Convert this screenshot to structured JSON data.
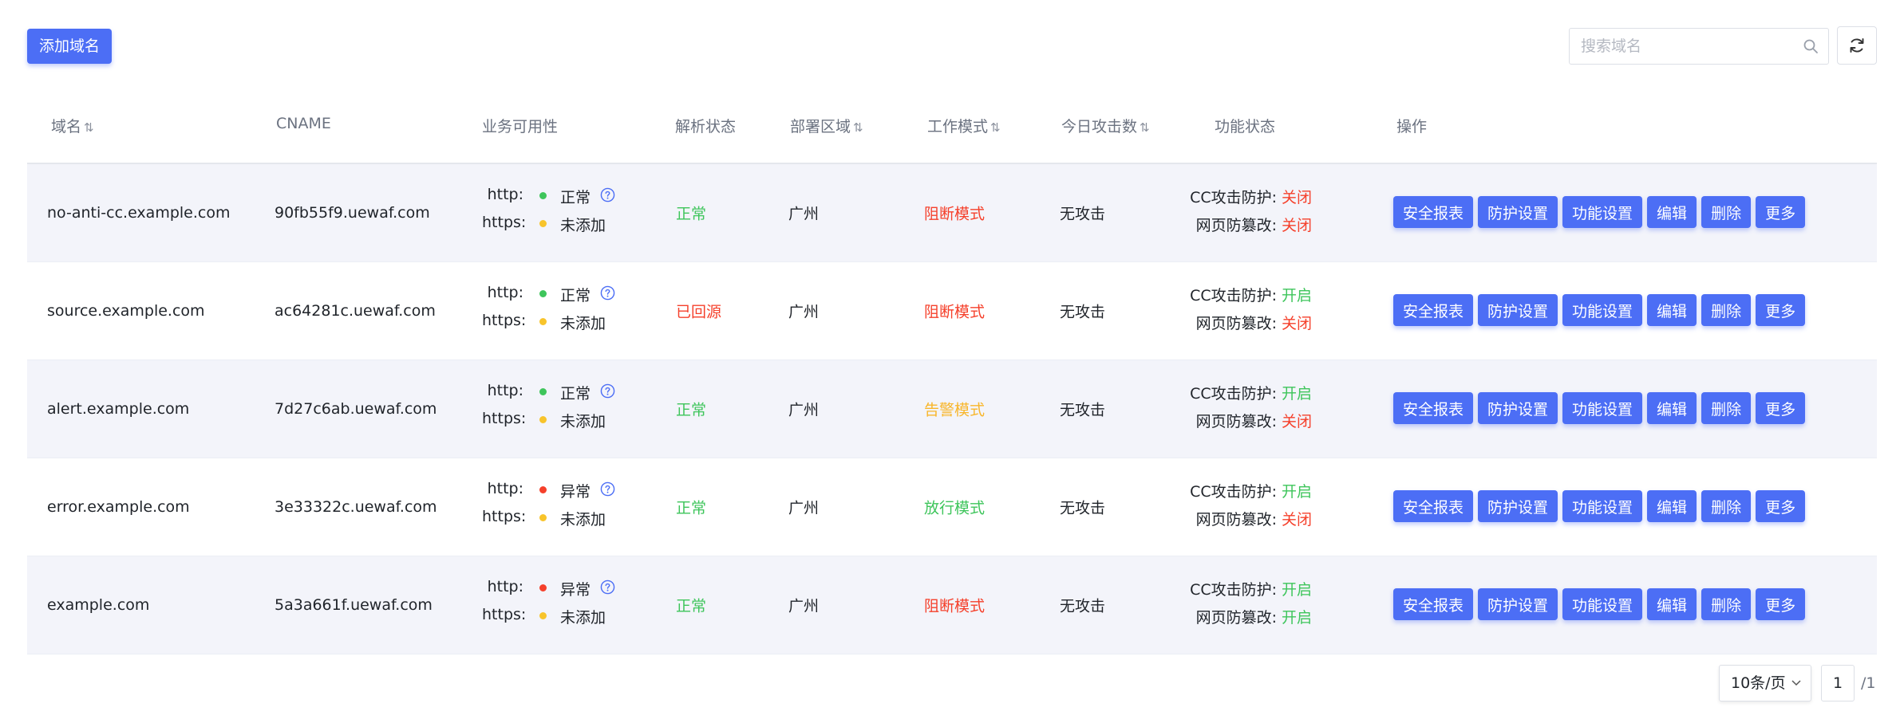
{
  "toolbar": {
    "add_label": "添加域名",
    "search_placeholder": "搜索域名"
  },
  "columns": {
    "domain": "域名",
    "cname": "CNAME",
    "availability": "业务可用性",
    "dns_status": "解析状态",
    "region": "部署区域",
    "mode": "工作模式",
    "attacks": "今日攻击数",
    "features": "功能状态",
    "actions": "操作"
  },
  "sort_glyph": "⇅",
  "labels": {
    "http": "http:",
    "https": "https:",
    "cc": "CC攻击防护:",
    "tamper": "网页防篡改:"
  },
  "actions": [
    "安全报表",
    "防护设置",
    "功能设置",
    "编辑",
    "删除",
    "更多"
  ],
  "rows": [
    {
      "domain": "no-anti-cc.example.com",
      "cname": "90fb55f9.uewaf.com",
      "http_status": "正常",
      "http_color": "green",
      "https_status": "未添加",
      "dns": "正常",
      "dns_color": "green",
      "region": "广州",
      "mode": "阻断模式",
      "mode_color": "red",
      "attacks": "无攻击",
      "cc": "关闭",
      "cc_color": "red",
      "tamper": "关闭",
      "tamper_color": "red"
    },
    {
      "domain": "source.example.com",
      "cname": "ac64281c.uewaf.com",
      "http_status": "正常",
      "http_color": "green",
      "https_status": "未添加",
      "dns": "已回源",
      "dns_color": "red",
      "region": "广州",
      "mode": "阻断模式",
      "mode_color": "red",
      "attacks": "无攻击",
      "cc": "开启",
      "cc_color": "green",
      "tamper": "关闭",
      "tamper_color": "red"
    },
    {
      "domain": "alert.example.com",
      "cname": "7d27c6ab.uewaf.com",
      "http_status": "正常",
      "http_color": "green",
      "https_status": "未添加",
      "dns": "正常",
      "dns_color": "green",
      "region": "广州",
      "mode": "告警模式",
      "mode_color": "orange",
      "attacks": "无攻击",
      "cc": "开启",
      "cc_color": "green",
      "tamper": "关闭",
      "tamper_color": "red"
    },
    {
      "domain": "error.example.com",
      "cname": "3e33322c.uewaf.com",
      "http_status": "异常",
      "http_color": "red",
      "https_status": "未添加",
      "dns": "正常",
      "dns_color": "green",
      "region": "广州",
      "mode": "放行模式",
      "mode_color": "green",
      "attacks": "无攻击",
      "cc": "开启",
      "cc_color": "green",
      "tamper": "关闭",
      "tamper_color": "red"
    },
    {
      "domain": "example.com",
      "cname": "5a3a661f.uewaf.com",
      "http_status": "异常",
      "http_color": "red",
      "https_status": "未添加",
      "dns": "正常",
      "dns_color": "green",
      "region": "广州",
      "mode": "阻断模式",
      "mode_color": "red",
      "attacks": "无攻击",
      "cc": "开启",
      "cc_color": "green",
      "tamper": "开启",
      "tamper_color": "green"
    }
  ],
  "pagination": {
    "page_size": "10条/页",
    "current": "1",
    "total": "/1"
  },
  "colors": {
    "primary": "#4c6ef5",
    "green": "#3ec55b",
    "red": "#f5402b",
    "orange": "#f8b62b"
  }
}
